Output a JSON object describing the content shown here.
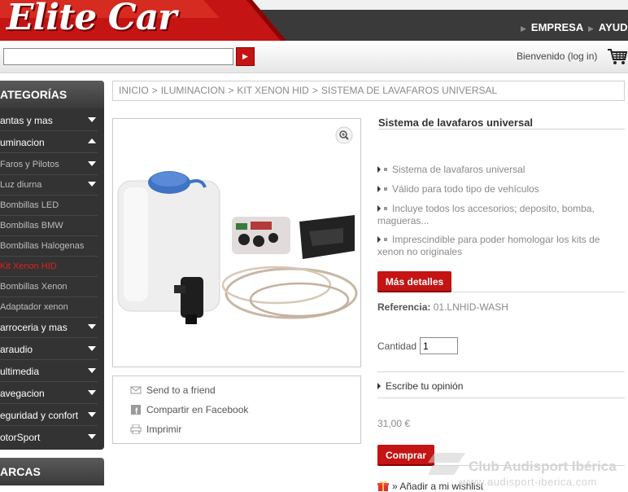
{
  "header": {
    "logo_text": "Elite Car",
    "nav": [
      "EMPRESA",
      "AYUDA"
    ],
    "search_value": "",
    "welcome": "Bienvenido (log in)"
  },
  "sidebar": {
    "categories_title": "ATEGORÍAS",
    "items": [
      {
        "label": "antas y mas"
      },
      {
        "label": "uminacion"
      },
      {
        "label": "Faros y Pilotos"
      },
      {
        "label": "Luz diurna"
      },
      {
        "label": "Bombillas LED"
      },
      {
        "label": "Bombillas BMW"
      },
      {
        "label": "Bombillas Halogenas"
      },
      {
        "label": "Kit Xenon HID"
      },
      {
        "label": "Bombillas Xenon"
      },
      {
        "label": "Adaptador xenon"
      },
      {
        "label": "arroceria y mas"
      },
      {
        "label": "araudio"
      },
      {
        "label": "ultimedia"
      },
      {
        "label": "avegacion"
      },
      {
        "label": "eguridad y confort"
      },
      {
        "label": "otorSport"
      }
    ],
    "brands_title": "ARCAS"
  },
  "breadcrumb": {
    "items": [
      "INICIO",
      "ILUMINACION",
      "KIT XENON HID",
      "SISTEMA DE LAVAFAROS UNIVERSAL"
    ],
    "separator": ">"
  },
  "actions": {
    "send": "Send to a friend",
    "facebook": "Compartir en Facebook",
    "print": "Imprimir"
  },
  "product": {
    "title": "Sistema de lavafaros universal",
    "features": [
      "Sistema de lavafaros universal",
      "Válido para todo tipo de vehículos",
      "Incluye todos los accesorios; deposito, bomba, magueras...",
      "Imprescindible para poder homologar los kits de xenon no originales"
    ],
    "more_button": "Más detalles",
    "reference_label": "Referencia:",
    "reference_value": "01.LNHID-WASH",
    "quantity_label": "Cantidad",
    "quantity_value": "1",
    "opinion": "Escribe tu opinión",
    "price": "31,00 €",
    "buy_button": "Comprar",
    "wishlist": "» Añadir a mi wishlist"
  },
  "watermark": {
    "name": "Club Audisport Ibérica",
    "url": "www.audisport-iberica.com"
  },
  "colors": {
    "accent_red": "#c41414",
    "sidebar_bg": "#333333",
    "topbar_bg": "#3a3a3a"
  }
}
